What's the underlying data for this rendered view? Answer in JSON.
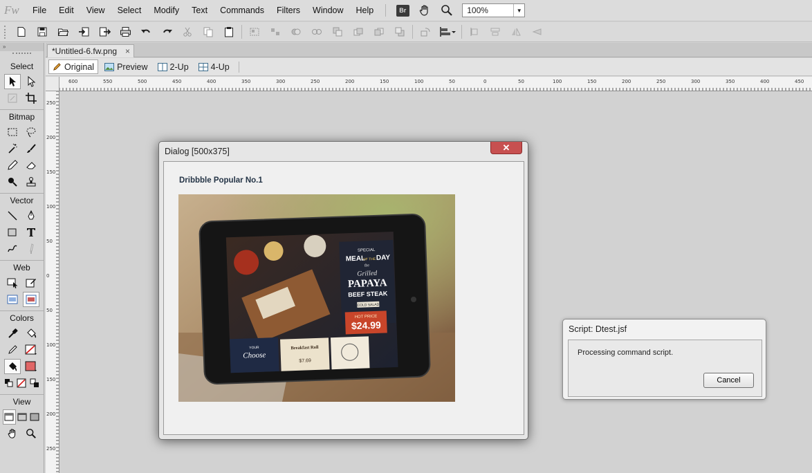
{
  "app": {
    "logo": "Fw",
    "br_badge": "Br"
  },
  "menu": [
    "File",
    "Edit",
    "View",
    "Select",
    "Modify",
    "Text",
    "Commands",
    "Filters",
    "Window",
    "Help"
  ],
  "zoom": {
    "value": "100%"
  },
  "document": {
    "tab_title": "*Untitled-6.fw.png",
    "close_glyph": "×"
  },
  "view_tabs": [
    "Original",
    "Preview",
    "2-Up",
    "4-Up"
  ],
  "panel": {
    "collapse_glyph": "»",
    "sections": [
      "Select",
      "Bitmap",
      "Vector",
      "Web",
      "Colors",
      "View"
    ]
  },
  "rulers": {
    "top": [
      "600",
      "550",
      "500",
      "450",
      "400",
      "350",
      "300",
      "250",
      "200",
      "150",
      "100",
      "50",
      "0",
      "50",
      "100",
      "150",
      "200",
      "250",
      "300",
      "350",
      "400",
      "450"
    ],
    "left": [
      "250",
      "200",
      "150",
      "100",
      "50",
      "0",
      "50",
      "100",
      "150",
      "200",
      "250"
    ]
  },
  "dialog": {
    "title": "Dialog [500x375]",
    "close_glyph": "✕",
    "heading": "Dribbble Popular No.1",
    "image_text": {
      "small": "SPECIAL",
      "meal": "MEAL",
      "of_the": "OF THE",
      "day": "DAY",
      "the": "the",
      "grilled": "Grilled",
      "papaya": "PAPAYA",
      "beef_steak": "BEEF STEAK",
      "cold_salad": "COLD SALAD",
      "hot_price": "HOT PRICE",
      "price": "$24.99",
      "breakfast": "Breakfast Roll",
      "breakfast_price": "$7.69",
      "choose": "Choose",
      "your": "YOUR"
    }
  },
  "script_dialog": {
    "title": "Script: Dtest.jsf",
    "message": "Processing command script.",
    "cancel_label": "Cancel"
  }
}
